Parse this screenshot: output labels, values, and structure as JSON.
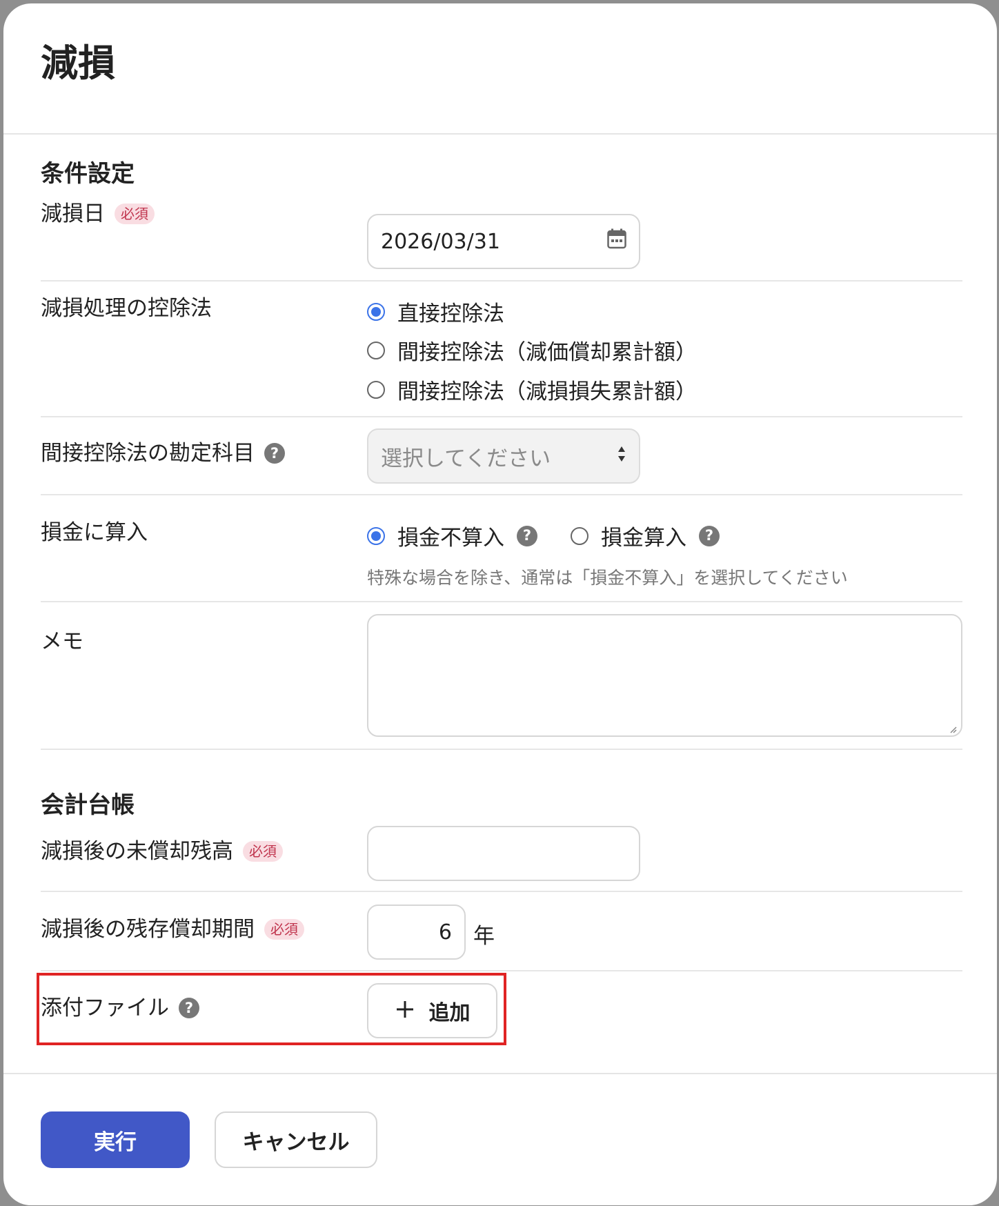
{
  "dialog": {
    "title": "減損"
  },
  "conditions": {
    "section_title": "条件設定",
    "impairment_date": {
      "label": "減損日",
      "required_badge": "必須",
      "value": "2026/03/31",
      "icon": "calendar-icon"
    },
    "deduction_method": {
      "label": "減損処理の控除法",
      "options": [
        {
          "label": "直接控除法",
          "checked": true
        },
        {
          "label": "間接控除法（減価償却累計額）",
          "checked": false
        },
        {
          "label": "間接控除法（減損損失累計額）",
          "checked": false
        }
      ]
    },
    "indirect_account": {
      "label": "間接控除法の勘定科目",
      "help": "?",
      "placeholder": "選択してください"
    },
    "deductible": {
      "label": "損金に算入",
      "options": [
        {
          "label": "損金不算入",
          "checked": true,
          "help": "?"
        },
        {
          "label": "損金算入",
          "checked": false,
          "help": "?"
        }
      ],
      "hint": "特殊な場合を除き、通常は「損金不算入」を選択してください"
    },
    "memo": {
      "label": "メモ",
      "value": ""
    }
  },
  "ledger": {
    "section_title": "会計台帳",
    "unamortized_balance": {
      "label": "減損後の未償却残高",
      "required_badge": "必須",
      "value": ""
    },
    "remaining_period": {
      "label": "減損後の残存償却期間",
      "required_badge": "必須",
      "value": "6",
      "unit": "年"
    },
    "attachment": {
      "label": "添付ファイル",
      "help": "?",
      "add_label": "追加"
    }
  },
  "footer": {
    "execute_label": "実行",
    "cancel_label": "キャンセル"
  },
  "colors": {
    "primary": "#4158c7",
    "radio_checked": "#3b73e8",
    "required_badge_text": "#c0344d",
    "required_badge_bg": "#f9dde2",
    "highlight": "#e02424"
  }
}
